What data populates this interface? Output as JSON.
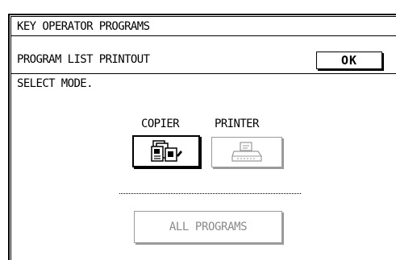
{
  "window": {
    "title": "KEY OPERATOR PROGRAMS"
  },
  "header": {
    "program_label": "PROGRAM LIST PRINTOUT",
    "ok_label": "OK"
  },
  "main": {
    "instruction": "SELECT MODE.",
    "modes": [
      {
        "label": "COPIER",
        "icon": "copier-icon",
        "enabled": true
      },
      {
        "label": "PRINTER",
        "icon": "printer-icon",
        "enabled": false
      }
    ],
    "all_programs_label": "ALL PROGRAMS",
    "all_programs_enabled": false
  },
  "colors": {
    "enabled": "#000000",
    "disabled": "#9a9a9a",
    "background": "#ffffff"
  }
}
